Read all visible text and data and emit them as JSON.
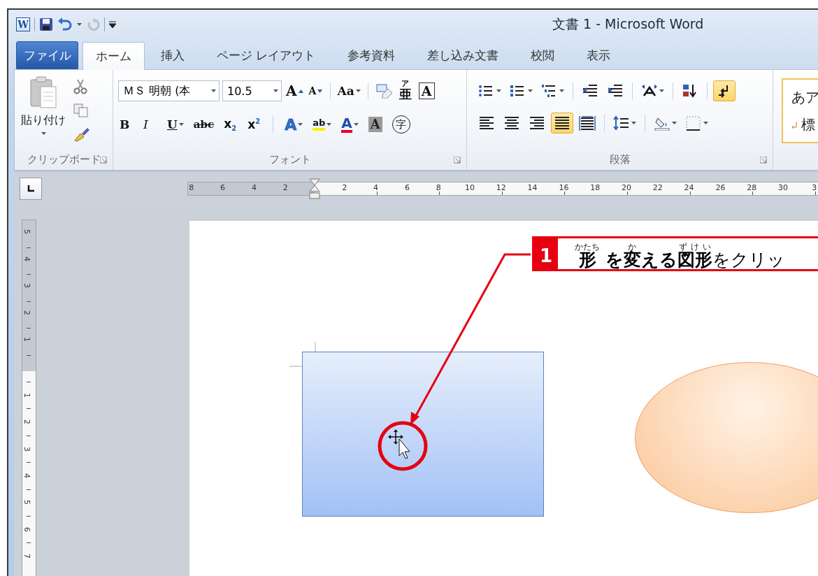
{
  "window": {
    "app_letter": "W",
    "title": "文書 1 - Microsoft Word"
  },
  "quick_access": [
    {
      "kind": "save",
      "disabled": false
    },
    {
      "kind": "undo",
      "disabled": false
    },
    {
      "kind": "redo",
      "disabled": true
    }
  ],
  "tabs": [
    {
      "label": "ファイル",
      "kind": "file",
      "selected": false
    },
    {
      "label": "ホーム",
      "kind": "tab",
      "selected": true
    },
    {
      "label": "挿入",
      "kind": "tab",
      "selected": false
    },
    {
      "label": "ページ レイアウト",
      "kind": "tab",
      "selected": false
    },
    {
      "label": "参考資料",
      "kind": "tab",
      "selected": false
    },
    {
      "label": "差し込み文書",
      "kind": "tab",
      "selected": false
    },
    {
      "label": "校閲",
      "kind": "tab",
      "selected": false
    },
    {
      "label": "表示",
      "kind": "tab",
      "selected": false
    }
  ],
  "ribbon": {
    "clipboard": {
      "paste_label": "貼り付け",
      "group_label": "クリップボード"
    },
    "font": {
      "font_name": "ＭＳ 明朝 (本",
      "font_size": "10.5",
      "group_label": "フォント",
      "row_1": [
        {
          "kind": "grow",
          "label": "A"
        },
        {
          "kind": "shrink",
          "label": "A"
        },
        {
          "kind": "separator"
        },
        {
          "kind": "case",
          "label": "Aa"
        },
        {
          "kind": "separator"
        },
        {
          "kind": "clear"
        },
        {
          "kind": "phonetic",
          "label": "亜",
          "ruby": "ア"
        },
        {
          "kind": "border",
          "label": "A"
        }
      ],
      "row_2": [
        {
          "kind": "bold",
          "label": "B"
        },
        {
          "kind": "italic",
          "label": "I"
        },
        {
          "kind": "underline",
          "label": "U"
        },
        {
          "kind": "strike",
          "label": "abc"
        },
        {
          "kind": "sub",
          "label": "x$_{2}$"
        },
        {
          "kind": "super",
          "label": "x$^{2}$"
        },
        {
          "kind": "separator"
        },
        {
          "kind": "effects",
          "label": "A"
        },
        {
          "kind": "highlight",
          "label": "ab"
        },
        {
          "kind": "color",
          "label": "A"
        },
        {
          "kind": "shade",
          "label": "A"
        },
        {
          "kind": "enclose",
          "label": "字"
        }
      ]
    },
    "paragraph": {
      "group_label": "段落",
      "row_1": [
        {
          "kind": "bullets",
          "selected": false
        },
        {
          "kind": "numbering",
          "selected": false
        },
        {
          "kind": "multilevel",
          "selected": false
        },
        {
          "kind": "separator"
        },
        {
          "kind": "decrease_indent",
          "selected": false
        },
        {
          "kind": "increase_indent",
          "selected": false
        },
        {
          "kind": "separator"
        },
        {
          "kind": "asian_layout",
          "selected": false
        },
        {
          "kind": "separator"
        },
        {
          "kind": "sort",
          "selected": false
        },
        {
          "kind": "separator"
        },
        {
          "kind": "show_marks",
          "selected": true
        }
      ],
      "row_2": [
        {
          "kind": "align_left",
          "selected": false
        },
        {
          "kind": "center",
          "selected": false
        },
        {
          "kind": "align_right",
          "selected": false
        },
        {
          "kind": "justify",
          "selected": true
        },
        {
          "kind": "distribute",
          "selected": false
        },
        {
          "kind": "separator"
        },
        {
          "kind": "line_spacing",
          "selected": false
        },
        {
          "kind": "separator"
        },
        {
          "kind": "shading",
          "selected": false
        },
        {
          "kind": "borders",
          "selected": false
        }
      ]
    },
    "styles": {
      "sample": "あア",
      "name": "標",
      "selected": true
    }
  },
  "ruler": {
    "left_numbers": [
      "8",
      "6",
      "4",
      "2"
    ],
    "numbers": [
      "2",
      "4",
      "6",
      "8",
      "10",
      "12",
      "14",
      "16",
      "18",
      "20",
      "22",
      "24",
      "26",
      "28",
      "30",
      "3"
    ]
  },
  "vertical_ruler": {
    "top_numbers": [
      "5",
      "4",
      "3",
      "2",
      "1"
    ],
    "numbers": [
      "1",
      "2",
      "3",
      "4",
      "5",
      "6",
      "7"
    ]
  },
  "callout": {
    "number": "1",
    "segments": [
      {
        "text": "**形**",
        "ruby": "かたち"
      },
      {
        "text": " **を**"
      },
      {
        "text": "**変**",
        "ruby": "か"
      },
      {
        "text": "**える**"
      },
      {
        "text": "**図形**",
        "ruby": "ずけい"
      },
      {
        "text": "をクリッ"
      }
    ]
  }
}
